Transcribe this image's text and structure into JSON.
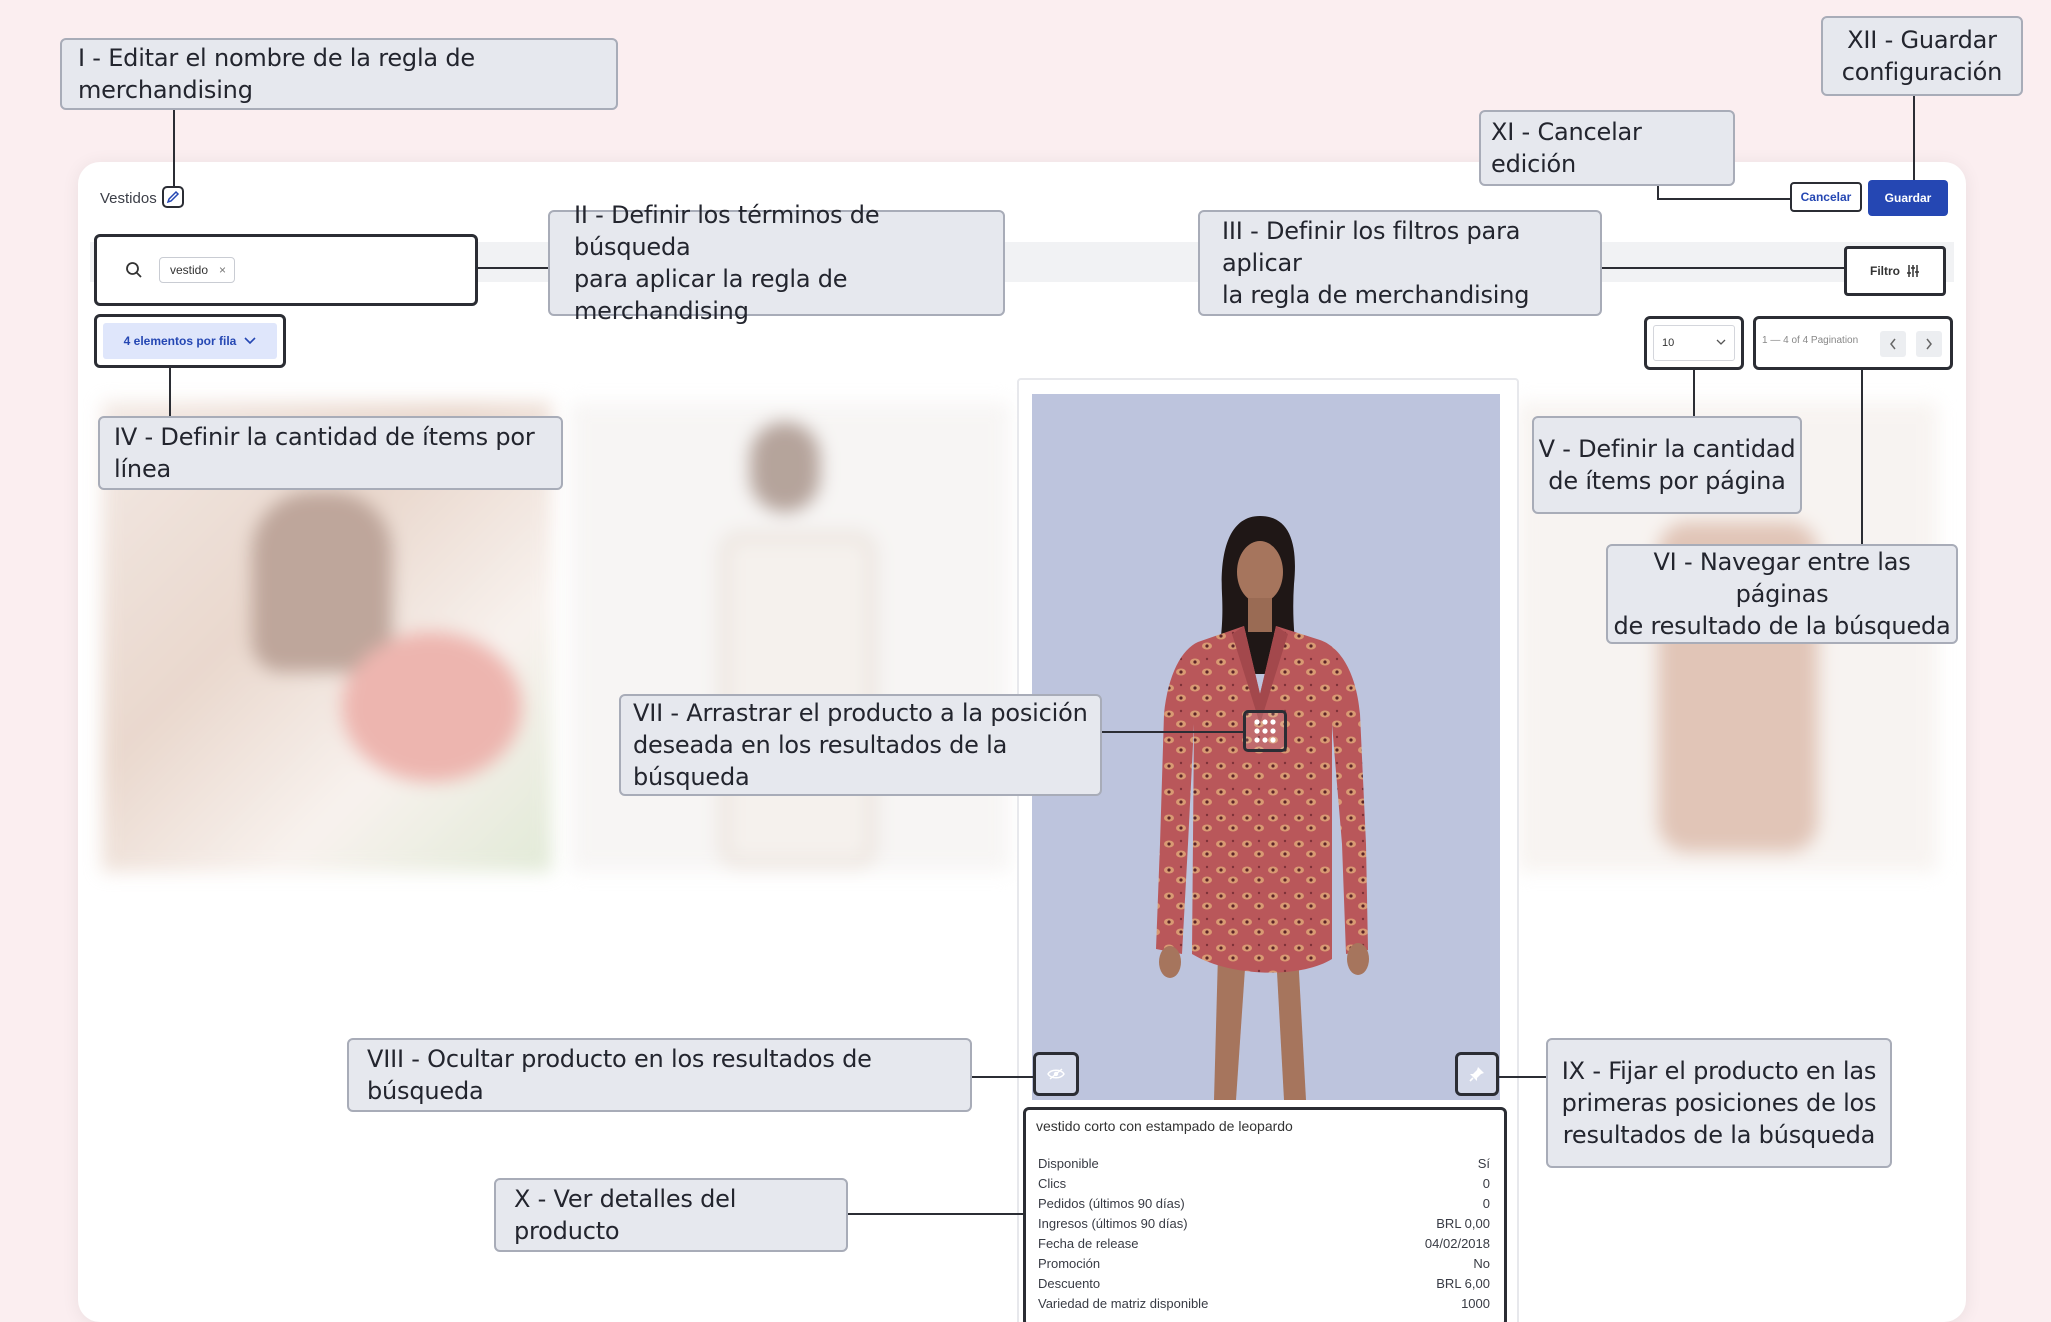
{
  "rule": {
    "name": "Vestidos"
  },
  "search": {
    "term": "vestido"
  },
  "filter": {
    "label": "Filtro"
  },
  "per_row": {
    "label": "4 elementos por fila"
  },
  "per_page": {
    "value": "10"
  },
  "pagination": {
    "label": "1 — 4 of 4 Pagination"
  },
  "actions": {
    "cancel": "Cancelar",
    "save": "Guardar"
  },
  "product": {
    "title": "vestido corto con estampado de leopardo",
    "details": [
      {
        "label": "Disponible",
        "value": "Sí"
      },
      {
        "label": "Clics",
        "value": "0"
      },
      {
        "label": "Pedidos (últimos 90 días)",
        "value": "0"
      },
      {
        "label": "Ingresos (últimos 90 días)",
        "value": "BRL 0,00"
      },
      {
        "label": "Fecha de release",
        "value": "04/02/2018"
      },
      {
        "label": "Promoción",
        "value": "No"
      },
      {
        "label": "Descuento",
        "value": "BRL 6,00"
      },
      {
        "label": "Variedad de matriz disponible",
        "value": "1000"
      }
    ]
  },
  "annotations": {
    "I": "I - Editar el nombre de la regla de merchandising",
    "II": "II - Definir los términos de búsqueda\npara aplicar la regla de merchandising",
    "III": "III - Definir los filtros para aplicar\nla regla de merchandising",
    "IV": "IV - Definir la cantidad de ítems por línea",
    "V": "V - Definir la cantidad\nde ítems por página",
    "VI": "VI - Navegar entre las páginas\nde resultado de la búsqueda",
    "VII": "VII - Arrastrar el producto a la posición\ndeseada en los resultados de la búsqueda",
    "VIII": "VIII - Ocultar producto en los resultados de búsqueda",
    "IX": "IX - Fijar el producto en las\nprimeras posiciones de los\nresultados de la búsqueda",
    "X": "X - Ver detalles del producto",
    "XI": "XI - Cancelar edición",
    "XII": "XII - Guardar\nconfiguración"
  },
  "colors": {
    "accent": "#2547b3",
    "background": "#fbeef0",
    "product_bg": "#bdc4dd"
  }
}
